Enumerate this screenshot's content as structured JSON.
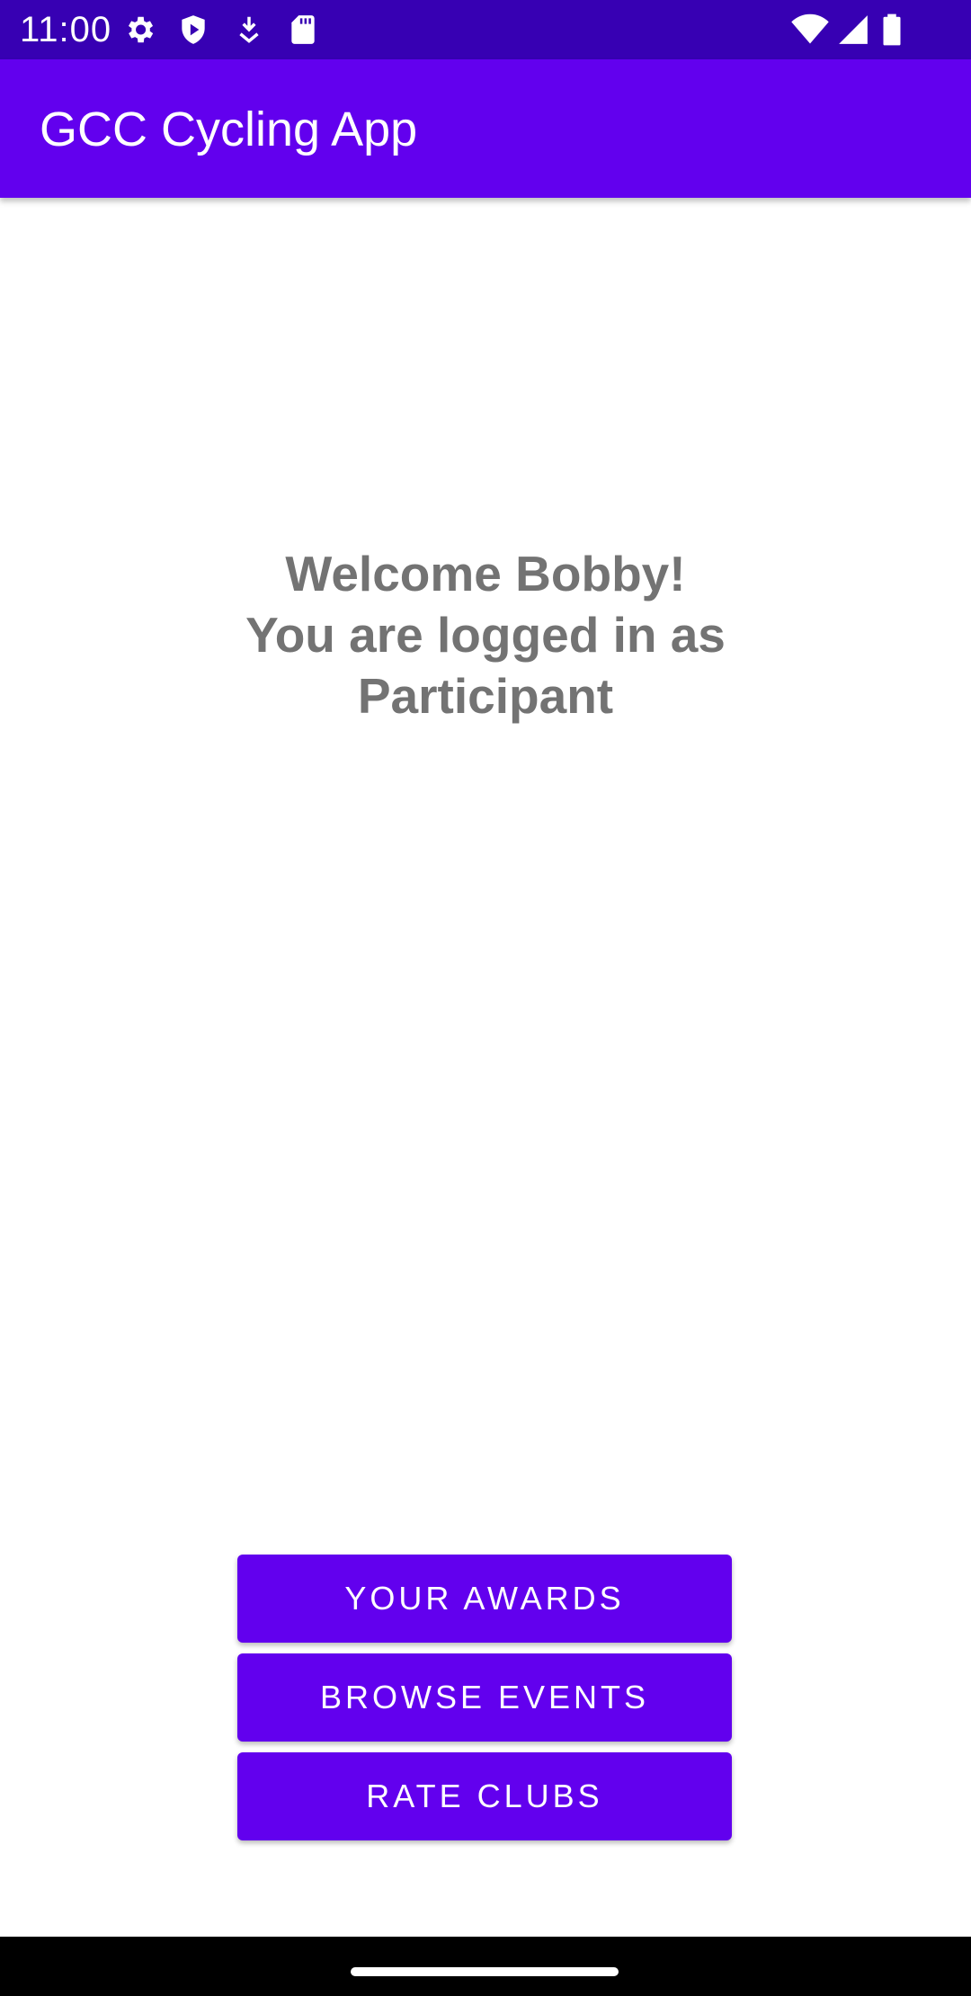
{
  "status_bar": {
    "time": "11:00",
    "left_icons": [
      "gear-icon",
      "shield-play-icon",
      "download-icon",
      "sd-card-icon"
    ],
    "right_icons": [
      "wifi-icon",
      "signal-icon",
      "battery-icon"
    ],
    "background_color": "#3700b3"
  },
  "app_bar": {
    "title": "GCC Cycling App",
    "background_color": "#6200ee"
  },
  "welcome": {
    "line1": "Welcome Bobby!",
    "line2": "You are logged in as",
    "line3": "Participant"
  },
  "buttons": {
    "awards_label": "YOUR AWARDS",
    "events_label": "BROWSE EVENTS",
    "clubs_label": "RATE CLUBS"
  }
}
